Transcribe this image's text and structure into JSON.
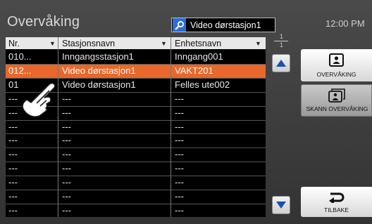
{
  "title": "Overvåking",
  "search": {
    "value": "Video dørstasjon1",
    "icon": "search-icon"
  },
  "clock": "12:00 PM",
  "table": {
    "columns": [
      "Nr.",
      "Stasjonsnavn",
      "Enhetsnavn"
    ],
    "rows": [
      [
        "010...",
        "Inngangsstasjon1",
        "Inngang001"
      ],
      [
        "012...",
        "Video dørstasjon1",
        "VAKT201"
      ],
      [
        "01",
        "Video dørstasjon1",
        "Felles ute002"
      ],
      [
        "---",
        "---",
        "---"
      ],
      [
        "---",
        "---",
        "---"
      ],
      [
        "---",
        "---",
        "---"
      ],
      [
        "---",
        "---",
        "---"
      ],
      [
        "---",
        "---",
        "---"
      ],
      [
        "---",
        "---",
        "---"
      ],
      [
        "---",
        "---",
        "---"
      ],
      [
        "---",
        "---",
        "---"
      ],
      [
        "---",
        "---",
        "---"
      ]
    ],
    "selected_row": 1
  },
  "pager": {
    "current": "1",
    "total": "1"
  },
  "buttons": {
    "monitor": "OVERVÅKING",
    "scan": "SKANN OVERVÅKING",
    "back": "TILBAKE"
  },
  "colors": {
    "selection": "#e8672a",
    "accent": "#2a6fd6"
  }
}
